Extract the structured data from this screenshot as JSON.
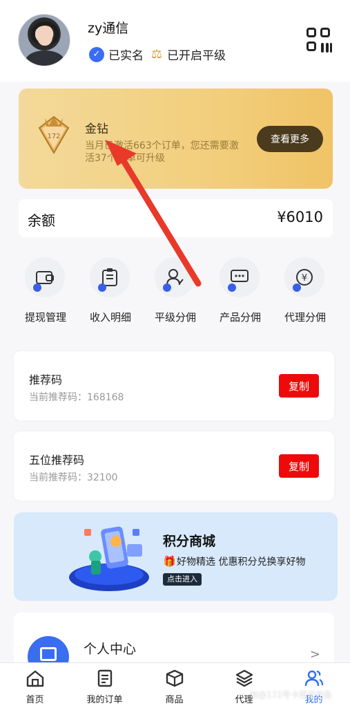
{
  "profile": {
    "username": "zy通信",
    "verified_label": "已实名",
    "level_status_label": "已开启平级"
  },
  "level_card": {
    "badge_text": "172",
    "level_name": "金钻",
    "description": "当月已激活663个订单，您还需要激活37个订单可升级",
    "more_button": "查看更多"
  },
  "balance": {
    "label": "余额",
    "value": "¥6010"
  },
  "actions": [
    {
      "label": "提现管理",
      "icon": "wallet-icon"
    },
    {
      "label": "收入明细",
      "icon": "clipboard-icon"
    },
    {
      "label": "平级分佣",
      "icon": "user-share-icon"
    },
    {
      "label": "产品分佣",
      "icon": "chat-card-icon"
    },
    {
      "label": "代理分佣",
      "icon": "yen-coin-icon"
    }
  ],
  "referral": {
    "title": "推荐码",
    "subtitle": "当前推荐码：168168",
    "copy_label": "复制"
  },
  "referral5": {
    "title": "五位推荐码",
    "subtitle": "当前推荐码：32100",
    "copy_label": "复制"
  },
  "mall": {
    "title": "积分商城",
    "subtitle": "好物精选 优惠积分兑换享好物",
    "button": "点击进入"
  },
  "personal": {
    "label": "个人中心"
  },
  "tabs": [
    {
      "label": "首页",
      "icon": "home-icon"
    },
    {
      "label": "我的订单",
      "icon": "order-icon"
    },
    {
      "label": "商品",
      "icon": "box-icon"
    },
    {
      "label": "代理",
      "icon": "layers-icon"
    },
    {
      "label": "我的",
      "icon": "users-icon"
    }
  ],
  "watermark": "知@172号卡渠道商备",
  "colors": {
    "accent": "#2f6ef0",
    "copy_button": "#ee0a0a",
    "level_card": "#f2cf7d",
    "annotation_arrow": "#e8392a"
  }
}
